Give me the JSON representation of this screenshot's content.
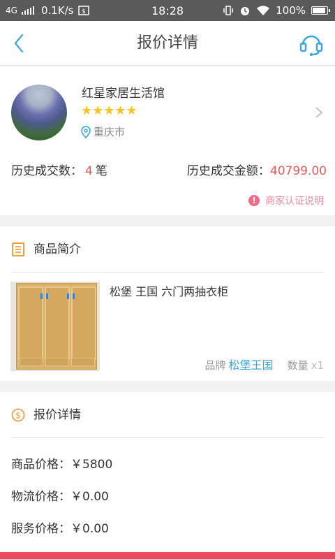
{
  "status_bar": {
    "network": "4G",
    "speed": "0.1K/s",
    "time": "18:28",
    "battery": "100%",
    "battery_level": 1.0
  },
  "nav": {
    "title": "报价详情"
  },
  "merchant": {
    "name": "红星家居生活馆",
    "rating": 5,
    "stars": "★★★★★",
    "location": "重庆市",
    "deal_count_label": "历史成交数：",
    "deal_count": "4",
    "deal_count_unit": "笔",
    "deal_amount_label": "历史成交金额：",
    "deal_amount": "40799.00",
    "cert_label": "商家认证说明"
  },
  "product_section": {
    "title": "商品简介",
    "name": "松堡 王国 六门两抽衣柜",
    "brand_label": "品牌",
    "brand": "松堡王国",
    "qty_label": "数量",
    "qty": "x1"
  },
  "quote_section": {
    "title": "报价详情",
    "rows": [
      {
        "label": "商品价格：",
        "value": "￥5800"
      },
      {
        "label": "物流价格：",
        "value": "￥0.00"
      },
      {
        "label": "服务价格：",
        "value": "￥0.00"
      }
    ]
  },
  "colors": {
    "accent": "#3ba6d8",
    "price_red": "#e35a5a",
    "star": "#f7c41b",
    "cert_pink": "#f08aa0",
    "section_orange": "#f0a040"
  }
}
